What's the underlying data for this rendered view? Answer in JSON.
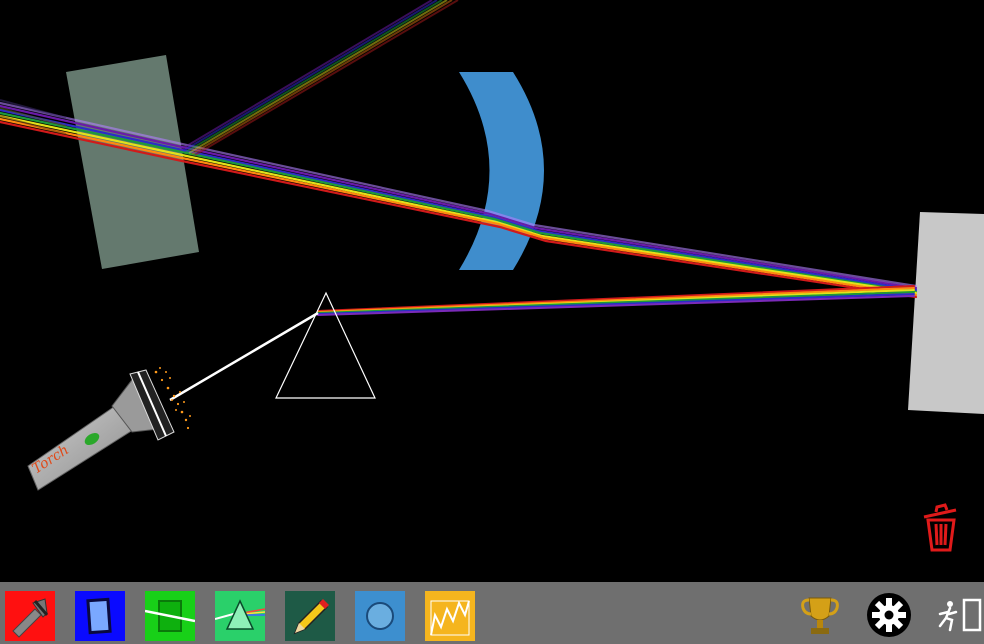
{
  "scene": {
    "torch_label": "Torch",
    "objects": [
      "glass-block",
      "concave-lens",
      "prism",
      "mirror",
      "torch"
    ],
    "trash_icon": "trash-icon"
  },
  "toolbar": {
    "tools": [
      {
        "name": "torch-tool",
        "icon": "flashlight-icon",
        "color": "#ff0000"
      },
      {
        "name": "block-tool",
        "icon": "glass-block-icon",
        "color": "#0000ff"
      },
      {
        "name": "green-block-tool",
        "icon": "green-block-icon",
        "color": "#00cc00"
      },
      {
        "name": "prism-tool",
        "icon": "prism-icon",
        "color": "#22cc66"
      },
      {
        "name": "pencil-tool",
        "icon": "pencil-icon",
        "color": "#1e5e4a"
      },
      {
        "name": "lens-tool",
        "icon": "lens-icon",
        "color": "#3d8fcf"
      },
      {
        "name": "zigzag-tool",
        "icon": "zigzag-icon",
        "color": "#f5b51e"
      }
    ],
    "trophy_icon": "trophy-icon",
    "settings_icon": "gear-icon",
    "exit_icon": "exit-icon"
  }
}
